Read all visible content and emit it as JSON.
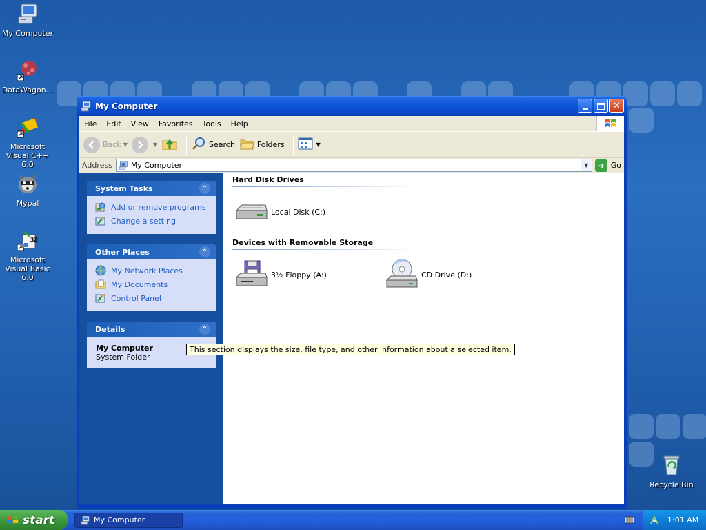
{
  "desktop": {
    "icons": [
      {
        "label": "My Computer",
        "icon": "my-computer-icon"
      },
      {
        "label": "DataWagon...",
        "icon": "datawagon-shortcut-icon"
      },
      {
        "label": "Microsoft Visual C++ 6.0",
        "icon": "visual-cpp-shortcut-icon"
      },
      {
        "label": "Mypal",
        "icon": "mypal-browser-icon"
      },
      {
        "label": "Microsoft Visual Basic 6.0",
        "icon": "visual-basic-shortcut-icon"
      },
      {
        "label": "Recycle Bin",
        "icon": "recycle-bin-icon"
      }
    ]
  },
  "window": {
    "title": "My Computer",
    "menu": [
      "File",
      "Edit",
      "View",
      "Favorites",
      "Tools",
      "Help"
    ],
    "toolbar": {
      "back": "Back",
      "search": "Search",
      "folders": "Folders"
    },
    "address": {
      "label": "Address",
      "value": "My Computer",
      "go": "Go"
    },
    "taskpane": {
      "system_tasks": {
        "title": "System Tasks",
        "links": [
          "Add or remove programs",
          "Change a setting"
        ]
      },
      "other_places": {
        "title": "Other Places",
        "links": [
          "My Network Places",
          "My Documents",
          "Control Panel"
        ]
      },
      "details": {
        "title": "Details",
        "name": "My Computer",
        "type": "System Folder"
      }
    },
    "groups": {
      "hard_disks": {
        "title": "Hard Disk Drives",
        "items": [
          "Local Disk (C:)"
        ]
      },
      "removable": {
        "title": "Devices with Removable Storage",
        "items": [
          "3½ Floppy (A:)",
          "CD Drive (D:)"
        ]
      }
    },
    "tooltip": "This section displays the size, file type, and other information about a selected item."
  },
  "taskbar": {
    "start": "start",
    "task_button": "My Computer",
    "clock": "1:01 AM"
  },
  "colors": {
    "title_blue": "#0c55d8",
    "taskpane_blue": "#154f9e",
    "link_blue": "#215dc6",
    "start_green": "#3c9a3c"
  }
}
